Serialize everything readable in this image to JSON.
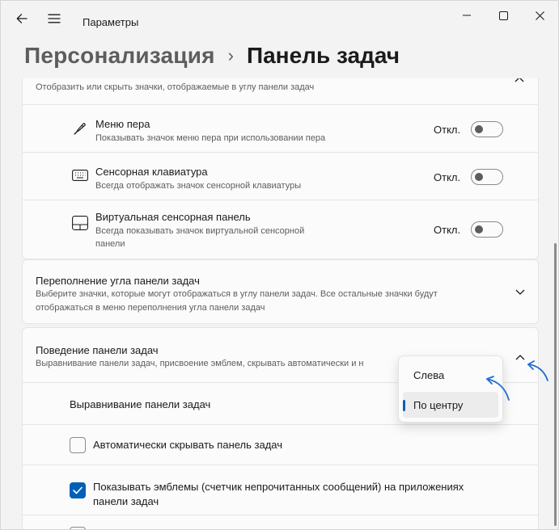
{
  "window": {
    "title": "Параметры",
    "controls": [
      "minimize",
      "maximize",
      "close"
    ]
  },
  "breadcrumb": {
    "parent": "Персонализация",
    "separator": "›",
    "current": "Панель задач"
  },
  "corner_icons": {
    "description": "Отобразить или скрыть значки, отображаемые в углу панели задач",
    "items": [
      {
        "icon": "pen-icon",
        "title": "Меню пера",
        "description": "Показывать значок меню пера при использовании пера",
        "state": "Откл."
      },
      {
        "icon": "keyboard-icon",
        "title": "Сенсорная клавиатура",
        "description": "Всегда отображать значок сенсорной клавиатуры",
        "state": "Откл."
      },
      {
        "icon": "touchpad-icon",
        "title": "Виртуальная сенсорная панель",
        "description_line1": "Всегда показывать значок виртуальной сенсорной",
        "description_line2": "панели",
        "state": "Откл."
      }
    ]
  },
  "overflow": {
    "title": "Переполнение угла панели задач",
    "description_line1": "Выберите значки, которые могут отображаться в углу панели задач. Все остальные значки будут",
    "description_line2": "отображаться в меню переполнения угла панели задач"
  },
  "behavior": {
    "title": "Поведение панели задач",
    "description": "Выравнивание панели задач, присвоение эмблем, скрывать автоматически и н",
    "alignment_label": "Выравнивание панели задач",
    "options": [
      {
        "label": "Слева"
      },
      {
        "label": "По центру",
        "selected": true
      }
    ],
    "autohide_label": "Автоматически скрывать панель задач",
    "autohide_checked": false,
    "badges_label_line1": "Показывать эмблемы (счетчик непрочитанных сообщений) на приложениях",
    "badges_label_line2": "панели задач",
    "badges_checked": true
  },
  "colors": {
    "accent": "#005fb8",
    "annotation_arrow": "#1f6fd6",
    "background": "#f3f3f3",
    "card": "#fbfbfb"
  }
}
